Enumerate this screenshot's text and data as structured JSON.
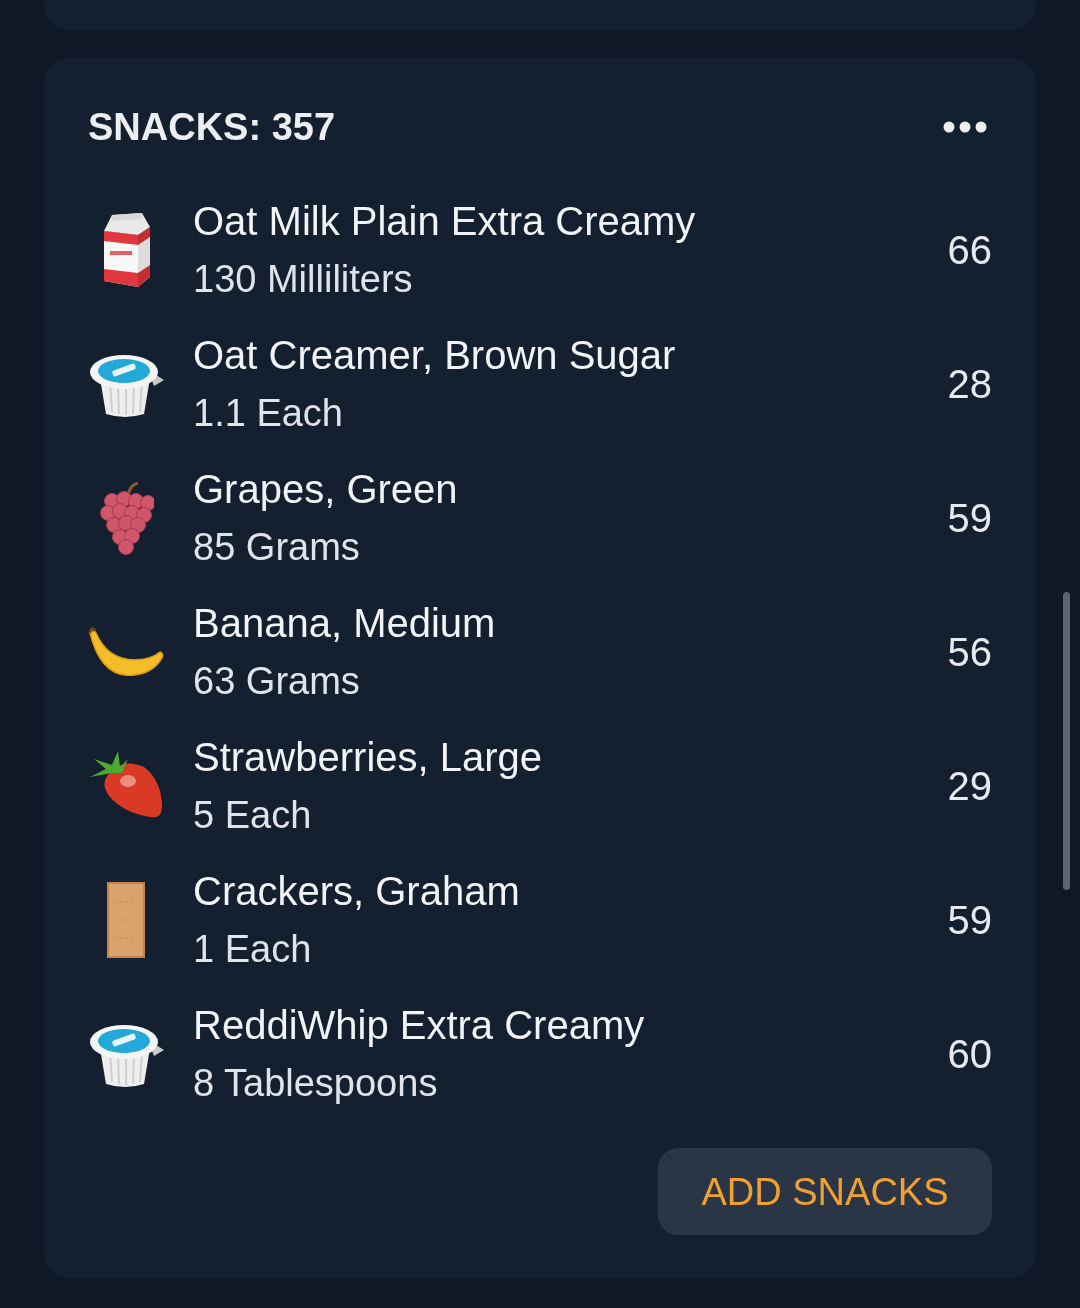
{
  "section": {
    "title": "SNACKS: 357",
    "items": [
      {
        "kind": "milk",
        "name": "Oat Milk Plain Extra Creamy",
        "amount": "130 Milliliters",
        "calories": "66"
      },
      {
        "kind": "creamer",
        "name": "Oat Creamer, Brown Sugar",
        "amount": "1.1 Each",
        "calories": "28"
      },
      {
        "kind": "grapes",
        "name": "Grapes, Green",
        "amount": "85 Grams",
        "calories": "59"
      },
      {
        "kind": "banana",
        "name": "Banana, Medium",
        "amount": "63 Grams",
        "calories": "56"
      },
      {
        "kind": "strawberry",
        "name": "Strawberries, Large",
        "amount": "5 Each",
        "calories": "29"
      },
      {
        "kind": "cracker",
        "name": "Crackers, Graham",
        "amount": "1 Each",
        "calories": "59"
      },
      {
        "kind": "creamer",
        "name": "ReddiWhip Extra Creamy",
        "amount": "8 Tablespoons",
        "calories": "60"
      }
    ],
    "button": "ADD SNACKS"
  }
}
